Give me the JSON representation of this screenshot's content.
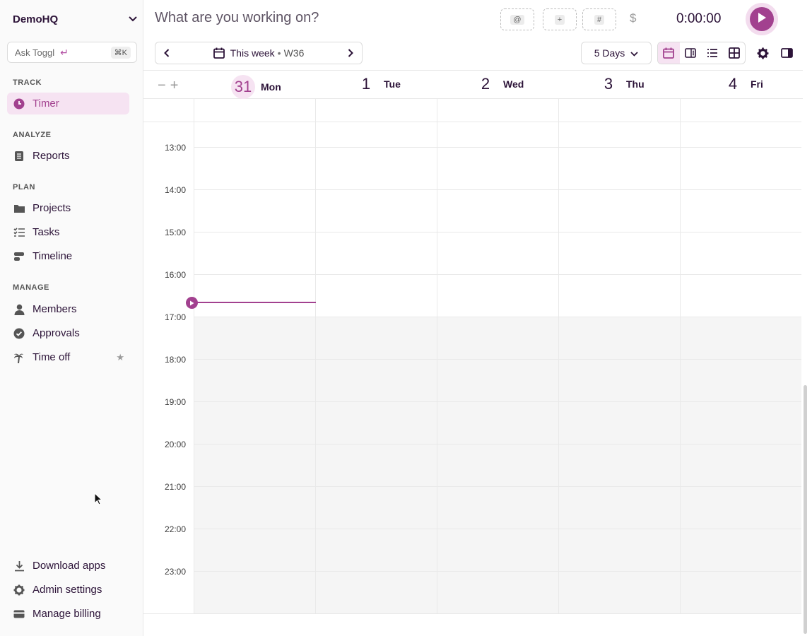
{
  "workspace": {
    "name": "DemoHQ"
  },
  "ask": {
    "label": "Ask Toggl",
    "shortcut": "⌘K"
  },
  "sidebar": {
    "sections": [
      {
        "title": "TRACK",
        "items": [
          {
            "label": "Timer",
            "icon": "clock-icon",
            "active": true
          }
        ]
      },
      {
        "title": "ANALYZE",
        "items": [
          {
            "label": "Reports",
            "icon": "document-icon"
          }
        ]
      },
      {
        "title": "PLAN",
        "items": [
          {
            "label": "Projects",
            "icon": "folder-icon"
          },
          {
            "label": "Tasks",
            "icon": "task-list-icon"
          },
          {
            "label": "Timeline",
            "icon": "timeline-icon"
          }
        ]
      },
      {
        "title": "MANAGE",
        "items": [
          {
            "label": "Members",
            "icon": "person-icon"
          },
          {
            "label": "Approvals",
            "icon": "check-circle-icon"
          },
          {
            "label": "Time off",
            "icon": "palm-tree-icon"
          }
        ]
      }
    ],
    "footer": [
      {
        "label": "Download apps",
        "icon": "download-icon"
      },
      {
        "label": "Admin settings",
        "icon": "gear-icon"
      },
      {
        "label": "Manage billing",
        "icon": "card-icon"
      }
    ]
  },
  "timer": {
    "placeholder": "What are you working on?",
    "tags": [
      "@",
      "+",
      "#"
    ],
    "billable": "$",
    "duration": "0:00:00"
  },
  "toolbar": {
    "range_label": "This week",
    "range_sep": "•",
    "week": "W36",
    "days_select": "5 Days"
  },
  "calendar": {
    "days": [
      {
        "num": "31",
        "name": "Mon",
        "today": true
      },
      {
        "num": "1",
        "name": "Tue"
      },
      {
        "num": "2",
        "name": "Wed"
      },
      {
        "num": "3",
        "name": "Thu"
      },
      {
        "num": "4",
        "name": "Fri"
      }
    ],
    "hours": [
      "13:00",
      "14:00",
      "15:00",
      "16:00",
      "17:00",
      "18:00",
      "19:00",
      "20:00",
      "21:00",
      "22:00",
      "23:00"
    ]
  },
  "colors": {
    "accent": "#a2418f",
    "accent_light": "#f6e3f2"
  }
}
